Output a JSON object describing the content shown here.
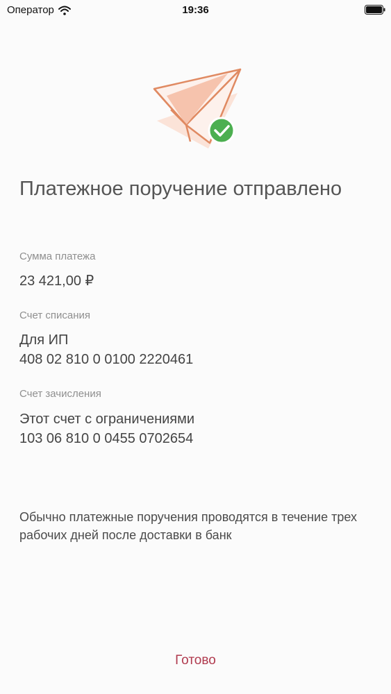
{
  "status_bar": {
    "carrier": "Оператор",
    "time": "19:36"
  },
  "main": {
    "title": "Платежное поручение отправлено",
    "amount": {
      "label": "Сумма платежа",
      "value": "23 421,00 ₽"
    },
    "debit_account": {
      "label": "Счет списания",
      "name": "Для ИП",
      "number": "408 02 810 0 0100 2220461"
    },
    "credit_account": {
      "label": "Счет зачисления",
      "name": "Этот счет с ограничениями",
      "number": "103 06 810 0 0455 0702654"
    },
    "note": "Обычно платежные поручения проводятся в течение трех рабочих дней после доставки в банк"
  },
  "footer": {
    "done_label": "Готово"
  },
  "colors": {
    "accent": "#b03a4e",
    "plane_stroke": "#e08a62",
    "plane_fill": "#f6c3ad",
    "check_green": "#4caf50"
  },
  "icons": {
    "hero": "paper-plane-check-icon",
    "wifi": "wifi-icon",
    "battery": "battery-icon"
  }
}
